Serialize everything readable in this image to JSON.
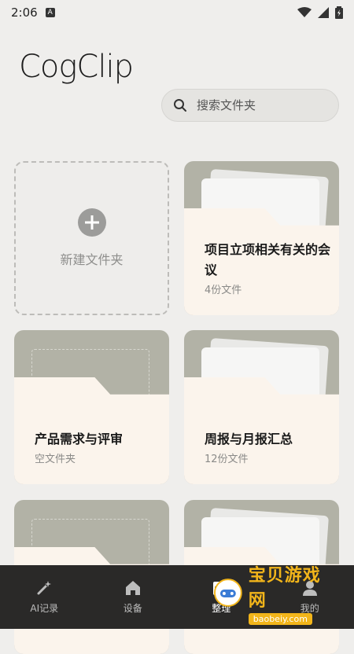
{
  "status_bar": {
    "time": "2:06",
    "notif": "A"
  },
  "app": {
    "logo": "CogClip"
  },
  "search": {
    "placeholder": "搜索文件夹"
  },
  "new_folder": {
    "label": "新建文件夹"
  },
  "folders": [
    {
      "title": "项目立项相关有关的会议",
      "count": "4份文件"
    },
    {
      "title": "产品需求与评审",
      "count": "空文件夹"
    },
    {
      "title": "周报与月报汇总",
      "count": "12份文件"
    }
  ],
  "tabs": [
    {
      "label": "AI记录",
      "icon": "magic-wand-icon"
    },
    {
      "label": "设备",
      "icon": "home-icon"
    },
    {
      "label": "整理",
      "icon": "folder-icon",
      "active": true
    },
    {
      "label": "我的",
      "icon": "user-icon"
    }
  ],
  "watermark": {
    "cn": "宝贝游戏网",
    "en": "baobeiy.com"
  }
}
